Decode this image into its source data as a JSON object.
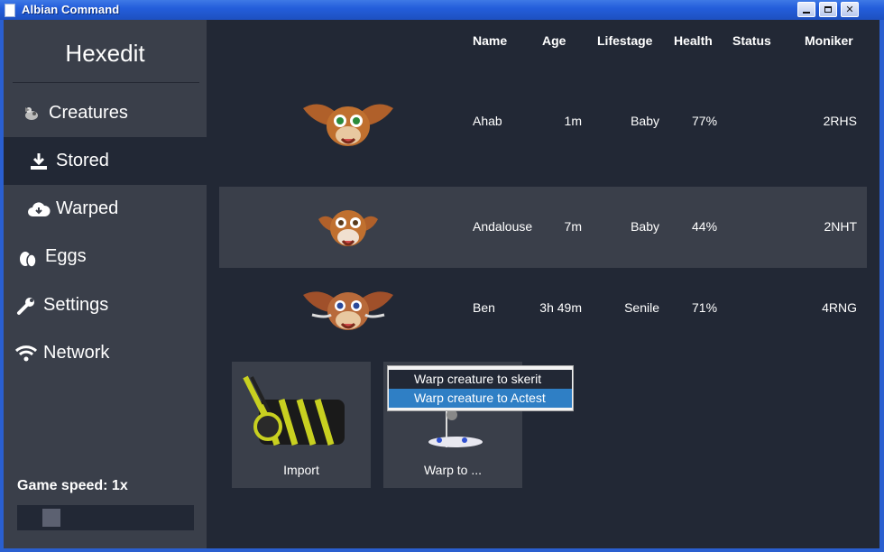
{
  "window": {
    "title": "Albian Command"
  },
  "sidebar": {
    "logo": "Hexedit",
    "items": [
      {
        "label": "Creatures",
        "icon": "creature-icon"
      },
      {
        "label": "Stored",
        "icon": "download-icon"
      },
      {
        "label": "Warped",
        "icon": "cloud-download-icon"
      },
      {
        "label": "Eggs",
        "icon": "egg-icon"
      },
      {
        "label": "Settings",
        "icon": "wrench-icon"
      },
      {
        "label": "Network",
        "icon": "wifi-icon"
      }
    ],
    "game_speed_label": "Game speed: 1x",
    "game_speed_value": 1
  },
  "table": {
    "headers": [
      "Name",
      "Age",
      "Lifestage",
      "Health",
      "Status",
      "Moniker"
    ],
    "rows": [
      {
        "name": "Ahab",
        "age": "1m",
        "lifestage": "Baby",
        "health": "77%",
        "status": "",
        "moniker": "2RHS"
      },
      {
        "name": "Andalouse",
        "age": "7m",
        "lifestage": "Baby",
        "health": "44%",
        "status": "",
        "moniker": "2NHT"
      },
      {
        "name": "Ben",
        "age": "3h 49m",
        "lifestage": "Senile",
        "health": "71%",
        "status": "",
        "moniker": "4RNG"
      }
    ]
  },
  "cards": [
    {
      "label": "Import"
    },
    {
      "label": "Warp to ..."
    }
  ],
  "context_menu": {
    "items": [
      "Warp creature to skerit",
      "Warp creature to Actest"
    ]
  },
  "colors": {
    "sidebar": "#3a3f4a",
    "background": "#222835",
    "highlight": "#2f7fc5"
  }
}
